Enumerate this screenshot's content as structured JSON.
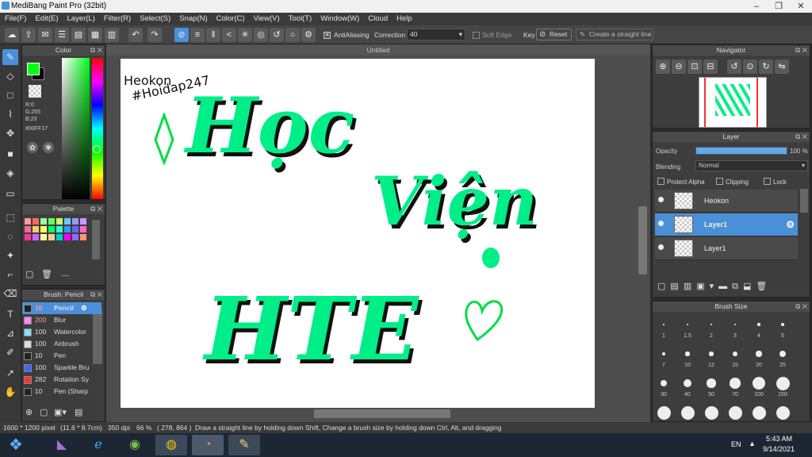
{
  "window": {
    "title": "MediBang Paint Pro (32bit)",
    "controls": [
      "–",
      "❐",
      "✕"
    ]
  },
  "menu": [
    "File(F)",
    "Edit(E)",
    "Layer(L)",
    "Filter(R)",
    "Select(S)",
    "Snap(N)",
    "Color(C)",
    "View(V)",
    "Tool(T)",
    "Window(W)",
    "Cloud",
    "Help"
  ],
  "toolbar": {
    "antialiasing_label": "AntiAliasing",
    "correction_label": "Correction",
    "correction_value": "40",
    "soft_edge_label": "Soft Edge",
    "key_label": "Key",
    "reset_label": "Reset",
    "straight_line_label": "Create a straight line"
  },
  "color_panel": {
    "title": "Color",
    "r": "R:0",
    "g": "G:255",
    "b": "B:23",
    "hex": "#00FF17",
    "foreground": "#00ff17"
  },
  "palette_panel": {
    "title": "Palette",
    "footer": "---",
    "colors": [
      "#ff9999",
      "#ff6666",
      "#99ff99",
      "#66ff66",
      "#ccff66",
      "#66ccff",
      "#9999ff",
      "#cc99ff",
      "#ff6699",
      "#ffcc66",
      "#ffff66",
      "#00ff66",
      "#33ffcc",
      "#3399ff",
      "#6666ff",
      "#ff66cc",
      "#ff3399",
      "#cc66ff",
      "#ffff99",
      "#ffcc99",
      "#00cccc",
      "#ff00ff",
      "#9966ff",
      "#ff9966"
    ]
  },
  "brush_panel": {
    "title": "Brush: Pencil",
    "items": [
      {
        "size": "10",
        "name": "Pencil",
        "color": "#222222"
      },
      {
        "size": "200",
        "name": "Blur",
        "color": "#ff88ff"
      },
      {
        "size": "100",
        "name": "Watercolor",
        "color": "#88ddff"
      },
      {
        "size": "100",
        "name": "Airbrush",
        "color": "#dddddd"
      },
      {
        "size": "10",
        "name": "Pen",
        "color": "#222222"
      },
      {
        "size": "100",
        "name": "Sparkle Bru",
        "color": "#4466ff"
      },
      {
        "size": "282",
        "name": "Rotation Sy",
        "color": "#ff3333"
      },
      {
        "size": "10",
        "name": "Pen (Sharp",
        "color": "#222222"
      }
    ]
  },
  "canvas": {
    "tab_title": "Untitled",
    "watermark_line1": "Heokon",
    "watermark_line2": "#Hoidap247",
    "art_line1": "Học",
    "art_line2": "Viện",
    "art_line3": "HTE",
    "art_color": "#00ee88"
  },
  "navigator": {
    "title": "Navigator"
  },
  "layer_panel": {
    "title": "Layer",
    "opacity_label": "Opacity",
    "opacity_value": "100 %",
    "opacity_fraction": 1.0,
    "blending_label": "Blending",
    "blending_value": "Normal",
    "protect_alpha": "Protect Alpha",
    "clipping": "Clipping",
    "lock": "Lock",
    "layers": [
      {
        "name": "Heokon",
        "selected": false
      },
      {
        "name": "Layer1",
        "selected": true
      },
      {
        "name": "Layer1",
        "selected": false
      }
    ]
  },
  "brush_size_panel": {
    "title": "Brush Size",
    "sizes": [
      "1",
      "1.5",
      "2",
      "3",
      "4",
      "5",
      "7",
      "10",
      "12",
      "15",
      "20",
      "25",
      "30",
      "40",
      "50",
      "70",
      "100",
      "150"
    ]
  },
  "status": {
    "size": "1600 * 1200 pixel",
    "dimensions": "(11.6 * 8.7cm)",
    "dpi": "350 dpi",
    "zoom": "66 %",
    "coords": "( 278, 864 )",
    "hint": "Draw a straight line by holding down Shift, Change a brush size by holding down Ctrl, Alt, and dragging"
  },
  "taskbar": {
    "lang": "EN",
    "time": "5:43 AM",
    "date": "9/14/2021"
  }
}
